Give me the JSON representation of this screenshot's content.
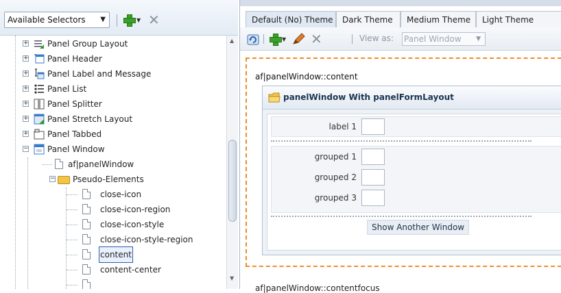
{
  "left_toolbar": {
    "selector_combo_label": "Available Selectors"
  },
  "tree": {
    "items": [
      {
        "label": "Panel Group Layout",
        "expander": "+"
      },
      {
        "label": "Panel Header",
        "expander": "+"
      },
      {
        "label": "Panel Label and Message",
        "expander": "+"
      },
      {
        "label": "Panel List",
        "expander": "+"
      },
      {
        "label": "Panel Splitter",
        "expander": "+"
      },
      {
        "label": "Panel Stretch Layout",
        "expander": "+"
      },
      {
        "label": "Panel Tabbed",
        "expander": "+"
      },
      {
        "label": "Panel Window",
        "expander": "−"
      },
      {
        "label": "af|panelWindow"
      },
      {
        "label": "Pseudo-Elements",
        "expander": "−"
      },
      {
        "label": "close-icon"
      },
      {
        "label": "close-icon-region"
      },
      {
        "label": "close-icon-style"
      },
      {
        "label": "close-icon-style-region"
      },
      {
        "label": "content"
      },
      {
        "label": "content-center"
      }
    ],
    "selected_index": 14
  },
  "right": {
    "tabs": [
      {
        "label": "Default (No) Theme"
      },
      {
        "label": "Dark Theme"
      },
      {
        "label": "Medium Theme"
      },
      {
        "label": "Light Theme"
      }
    ],
    "active_tab": 0,
    "view_as_label": "View as:",
    "view_as_value": "Panel Window",
    "content_selector": "af|panelWindow::content",
    "panel": {
      "title": "panelWindow With panelFormLayout",
      "fields": [
        {
          "label": "label 1",
          "value": ""
        },
        {
          "label": "grouped 1",
          "value": ""
        },
        {
          "label": "grouped 2",
          "value": ""
        },
        {
          "label": "grouped 3",
          "value": ""
        }
      ],
      "button_label": "Show Another Window"
    },
    "next_selector": "af|panelWindow::contentfocus"
  },
  "colors": {
    "accent_dashed_border": "#f08a24",
    "selection_outline": "#2f5ea8",
    "add_icon": "#3ca12a"
  }
}
